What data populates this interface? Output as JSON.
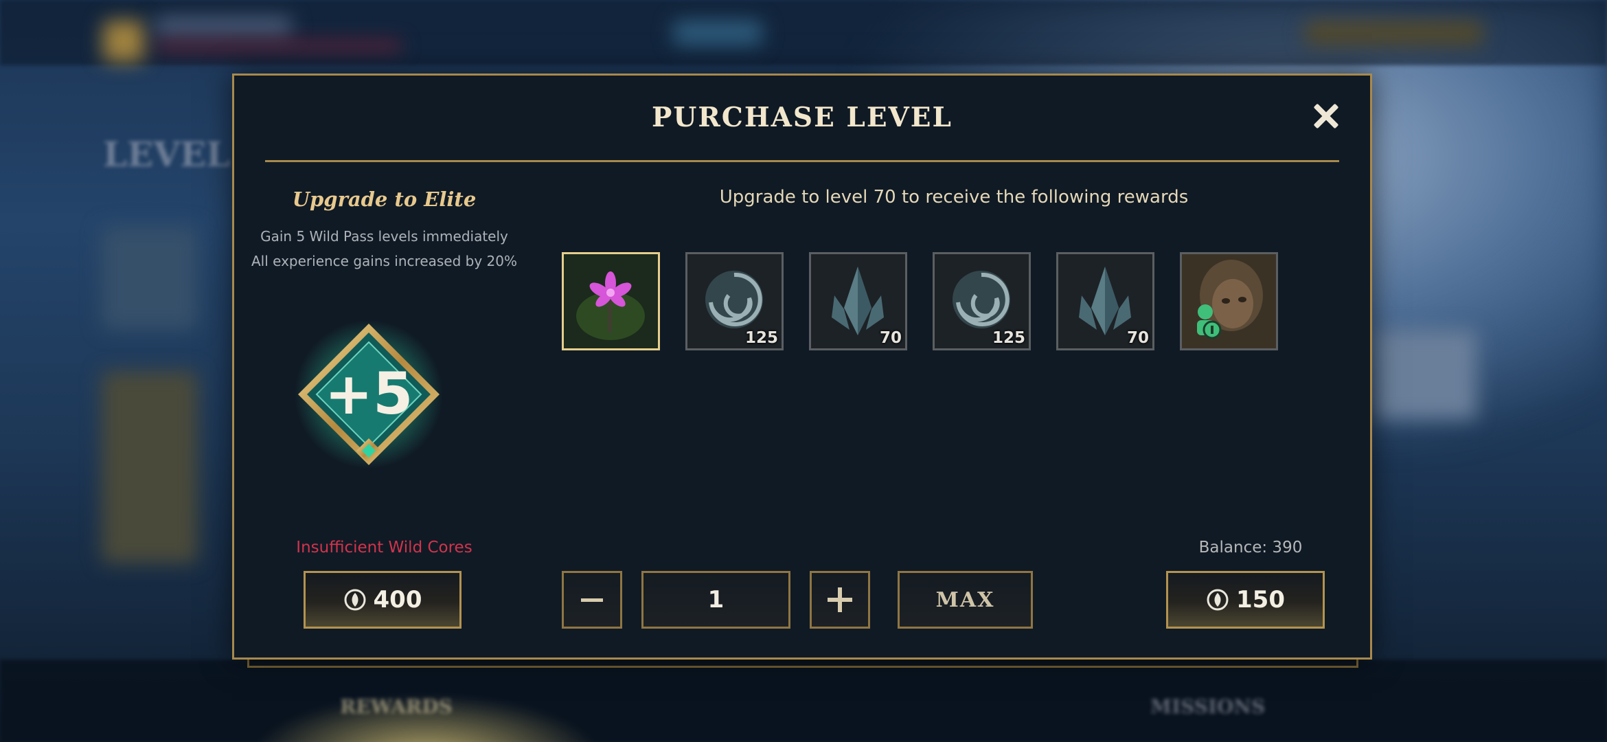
{
  "background": {
    "screen_title": "LEVEL",
    "bottom_tabs": [
      "REWARDS",
      "MISSIONS"
    ]
  },
  "dialog": {
    "title": "PURCHASE LEVEL",
    "close_icon": "close-icon"
  },
  "elite": {
    "heading": "Upgrade to Elite",
    "line1": "Gain 5 Wild Pass levels immediately",
    "line2": "All experience gains increased by 20%",
    "badge_text": "+5",
    "error": "Insufficient Wild Cores",
    "price": "400",
    "price_icon": "wild-core-icon"
  },
  "rewards": {
    "heading": "Upgrade to level 70 to receive the following rewards",
    "items": [
      {
        "name": "flower-emote",
        "count": ""
      },
      {
        "name": "poro-coins",
        "count": "125"
      },
      {
        "name": "blue-essence-shards",
        "count": "70"
      },
      {
        "name": "poro-coins",
        "count": "125"
      },
      {
        "name": "blue-essence-shards",
        "count": "70"
      },
      {
        "name": "champion-icon",
        "count": ""
      }
    ]
  },
  "purchase": {
    "quantity": "1",
    "minus_icon": "minus-icon",
    "plus_icon": "plus-icon",
    "max_label": "MAX",
    "balance": "Balance: 390",
    "price": "150",
    "price_icon": "wild-core-icon"
  },
  "colors": {
    "gold_border": "#a88a4c",
    "panel_bg": "#101a25",
    "error_red": "#d2344c",
    "title_text": "#f2e7cc"
  }
}
